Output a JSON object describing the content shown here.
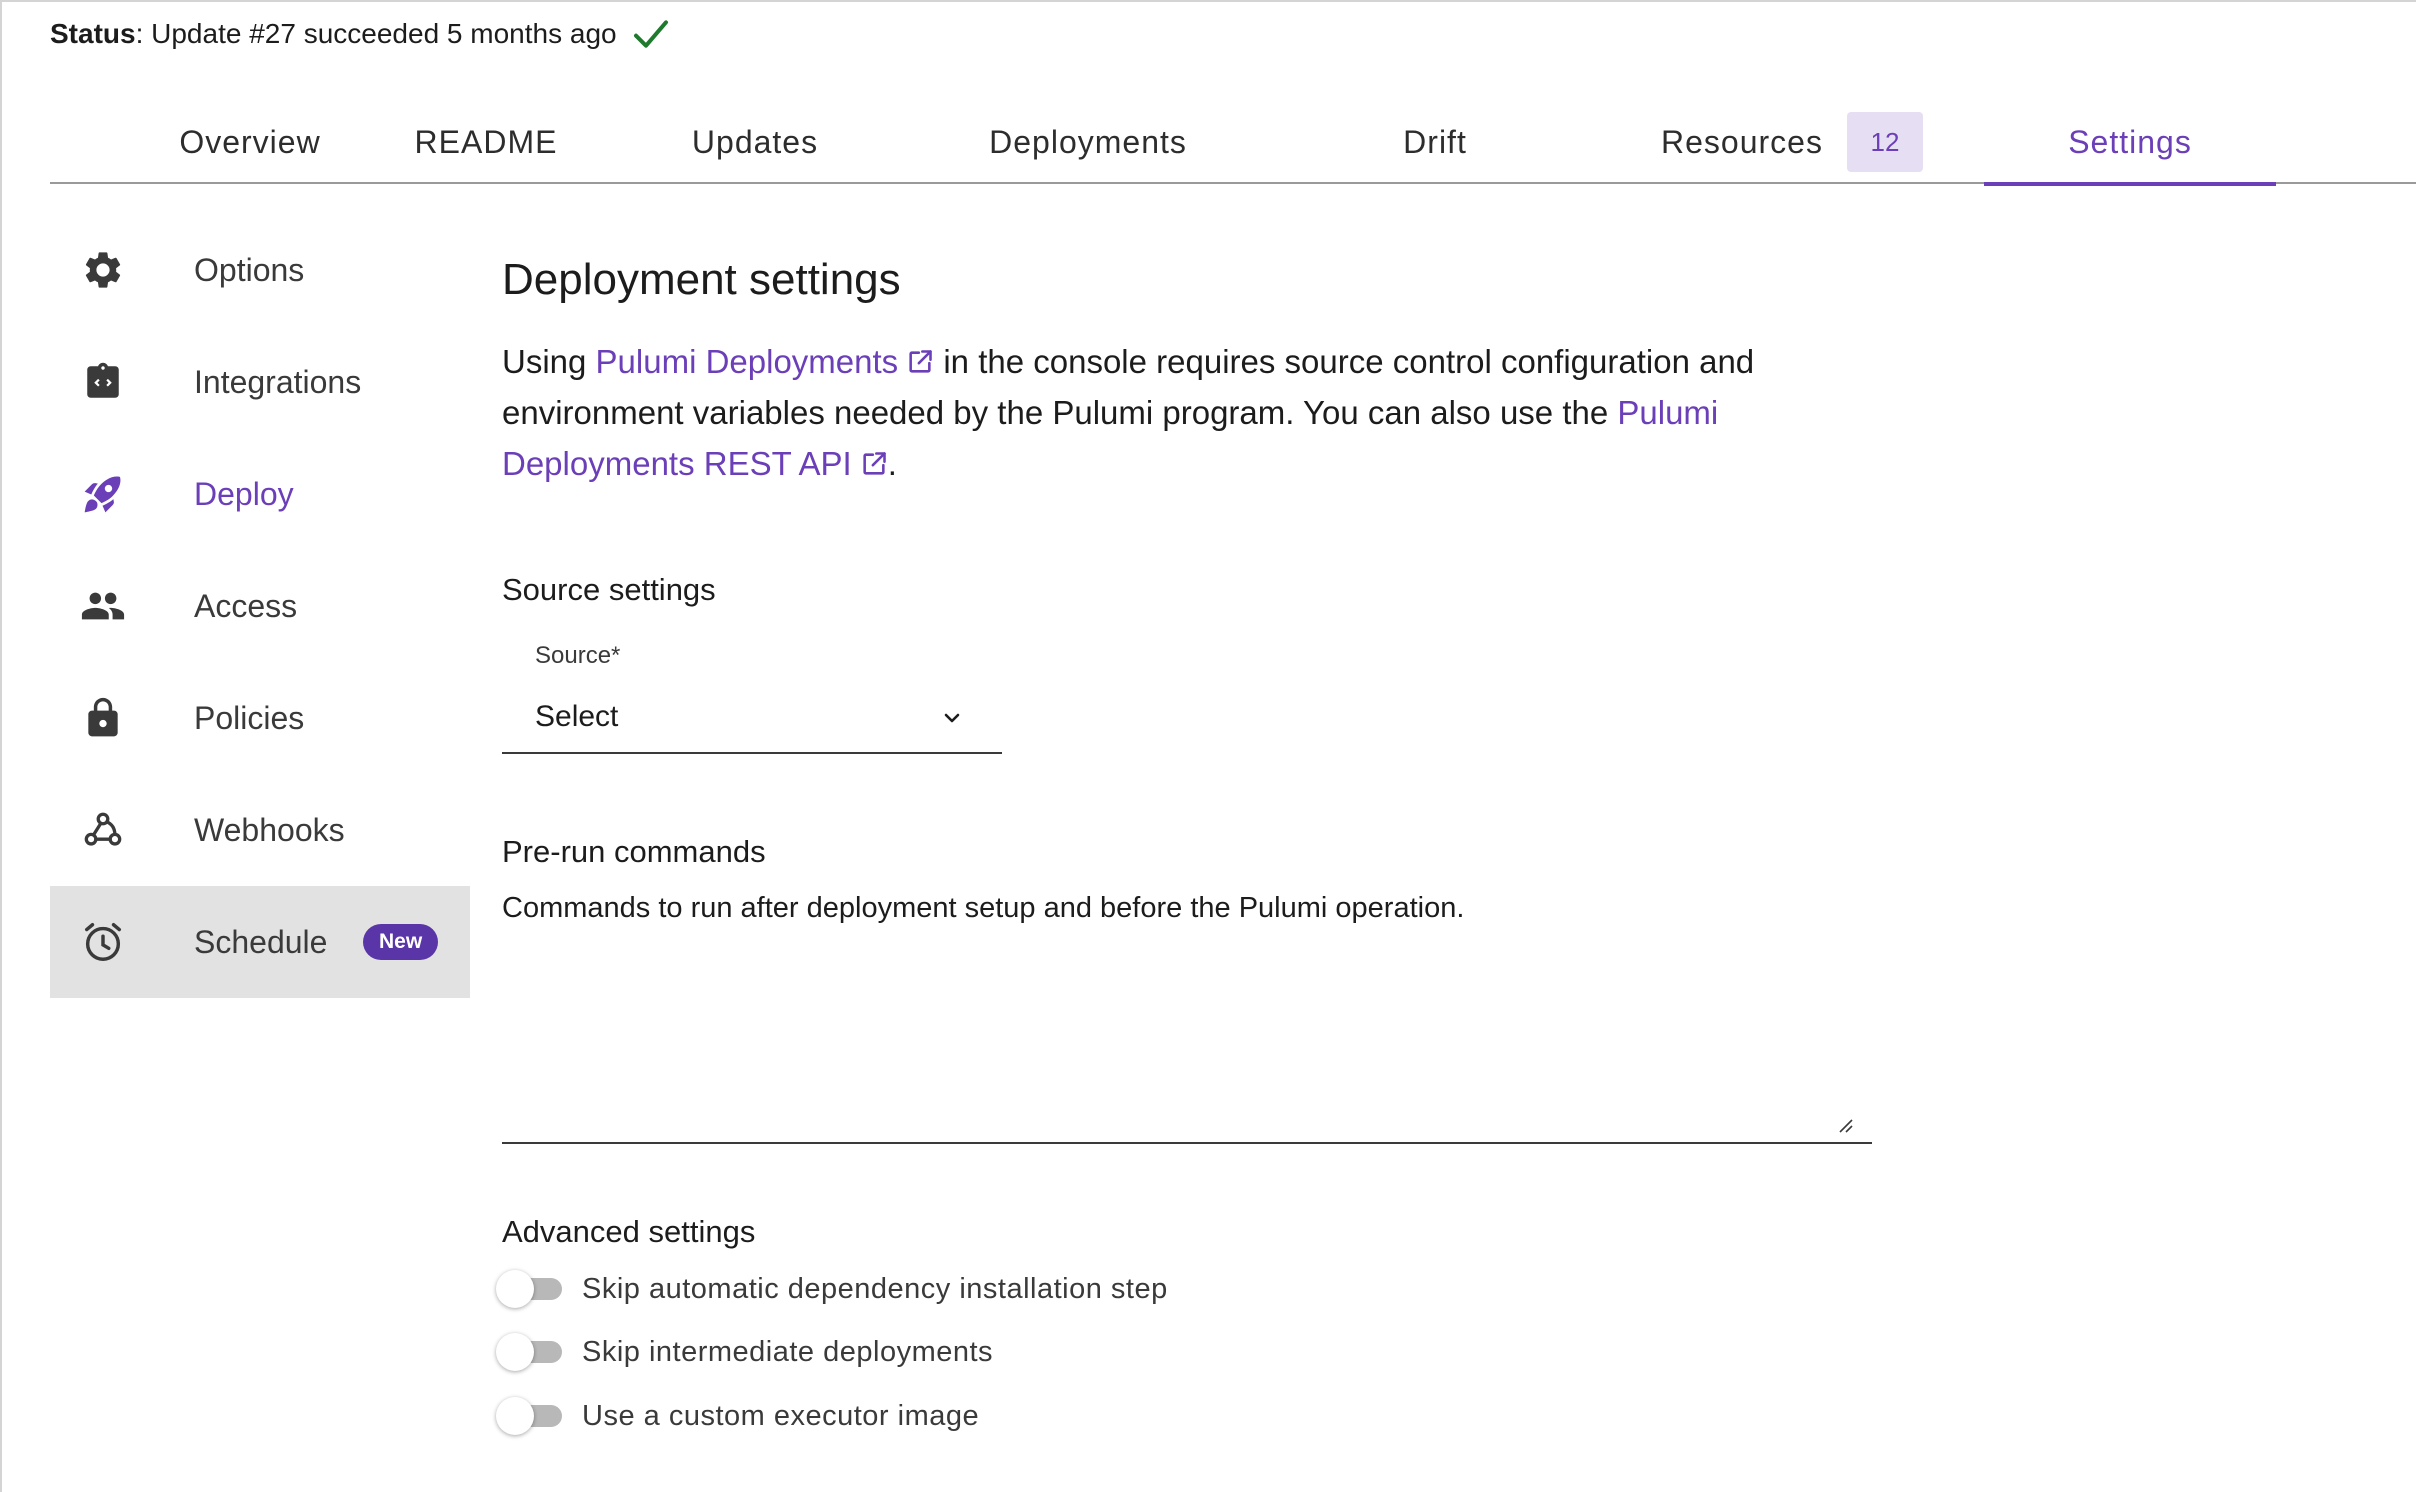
{
  "status": {
    "label": "Status",
    "text": ": Update #27 succeeded 5 months ago",
    "icon": "check-icon",
    "icon_color": "#1f7a2e"
  },
  "tabs": [
    {
      "label": "Overview"
    },
    {
      "label": "README"
    },
    {
      "label": "Updates"
    },
    {
      "label": "Deployments"
    },
    {
      "label": "Drift"
    },
    {
      "label": "Resources",
      "count": "12"
    },
    {
      "label": "Settings",
      "active": true
    }
  ],
  "sidebar": {
    "items": [
      {
        "label": "Options",
        "icon": "gear-icon"
      },
      {
        "label": "Integrations",
        "icon": "integration-icon"
      },
      {
        "label": "Deploy",
        "icon": "rocket-icon",
        "active": true
      },
      {
        "label": "Access",
        "icon": "people-icon"
      },
      {
        "label": "Policies",
        "icon": "lock-icon"
      },
      {
        "label": "Webhooks",
        "icon": "webhook-icon"
      },
      {
        "label": "Schedule",
        "icon": "alarm-clock-icon",
        "badge": "New"
      }
    ]
  },
  "main": {
    "title": "Deployment settings",
    "intro": {
      "prefix": "Using ",
      "link1": "Pulumi Deployments",
      "middle": " in the console requires source control configuration and environment variables needed by the Pulumi program. You can also use the ",
      "link2": "Pulumi Deployments REST API",
      "suffix": "."
    },
    "source": {
      "title": "Source settings",
      "field_label": "Source*",
      "value": "Select"
    },
    "pre_run": {
      "title": "Pre-run commands",
      "description": "Commands to run after deployment setup and before the Pulumi operation.",
      "value": ""
    },
    "advanced": {
      "title": "Advanced settings",
      "toggles": [
        {
          "label": "Skip automatic dependency installation step",
          "on": false
        },
        {
          "label": "Skip intermediate deployments",
          "on": false
        },
        {
          "label": "Use a custom executor image",
          "on": false
        }
      ]
    }
  },
  "colors": {
    "accent": "#6b3fb8",
    "badge_bg": "#5a35a8",
    "count_bg": "#e6dff3"
  }
}
